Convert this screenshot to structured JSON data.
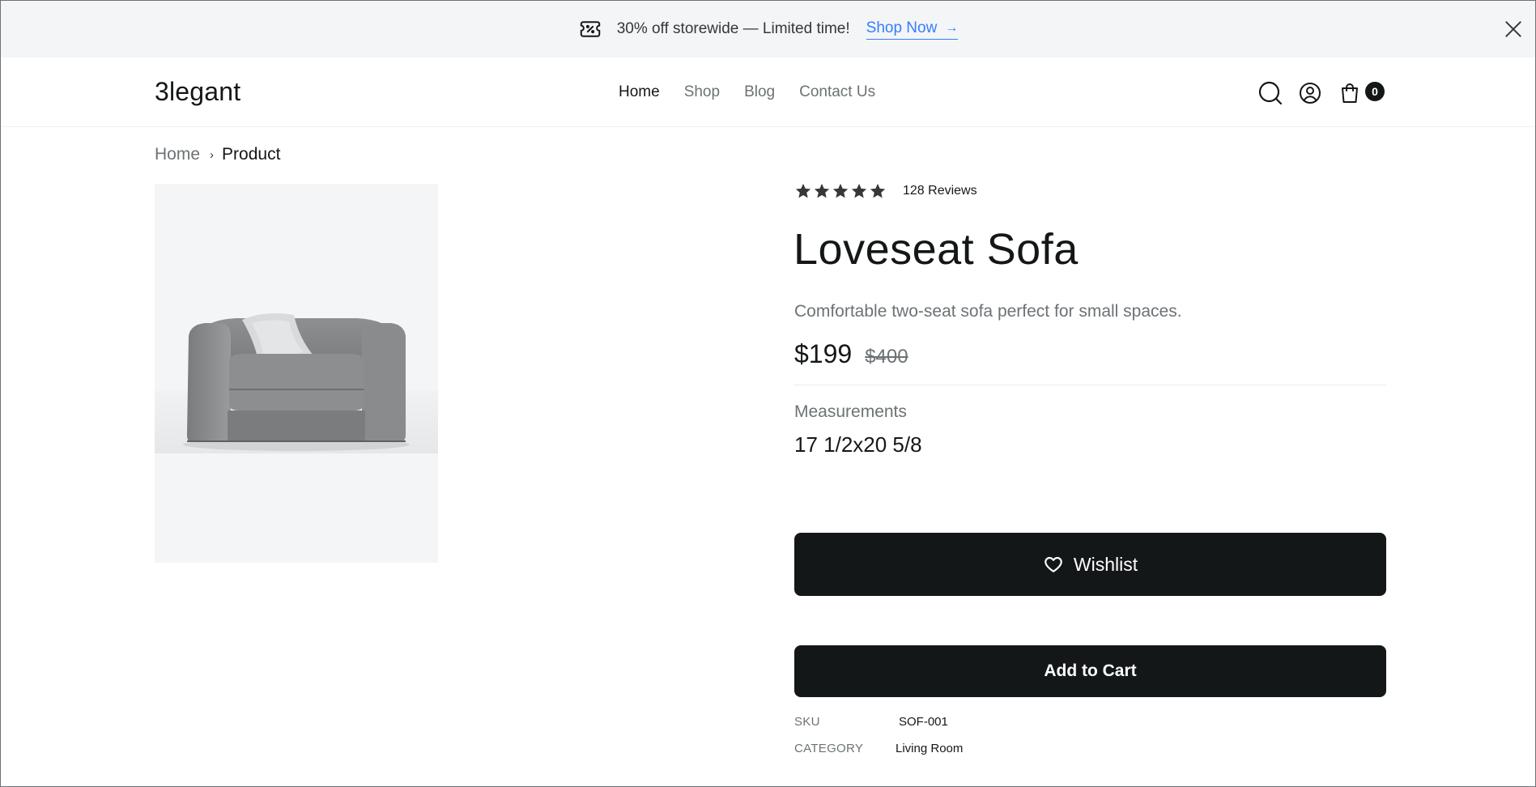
{
  "banner": {
    "text": "30% off storewide — Limited time!",
    "link_label": "Shop Now",
    "link_arrow": "→"
  },
  "header": {
    "logo": "3legant",
    "nav": [
      "Home",
      "Shop",
      "Blog",
      "Contact Us"
    ],
    "cart_count": "0"
  },
  "breadcrumb": {
    "home": "Home",
    "separator": "›",
    "current": "Product"
  },
  "product": {
    "rating": 5,
    "reviews": "128 Reviews",
    "title": "Loveseat Sofa",
    "description": "Comfortable two-seat sofa perfect for small spaces.",
    "price": "$199",
    "old_price": "$400",
    "measurements_label": "Measurements",
    "measurements_value": "17 1/2x20 5/8",
    "wishlist_label": "Wishlist",
    "add_to_cart_label": "Add to Cart",
    "sku_label": "SKU",
    "sku_value": "SOF-001",
    "category_label": "CATEGORY",
    "category_value": "Living Room"
  },
  "colors": {
    "primary": "#141718",
    "muted": "#6c7275",
    "banner_bg": "#f3f5f7",
    "link": "#377dff"
  },
  "icons": {
    "banner": "ticket-percent-icon",
    "close": "close-icon",
    "search": "search-icon",
    "account": "user-circle-icon",
    "cart": "shopping-bag-icon",
    "star": "star-icon",
    "wishlist": "heart-icon"
  }
}
